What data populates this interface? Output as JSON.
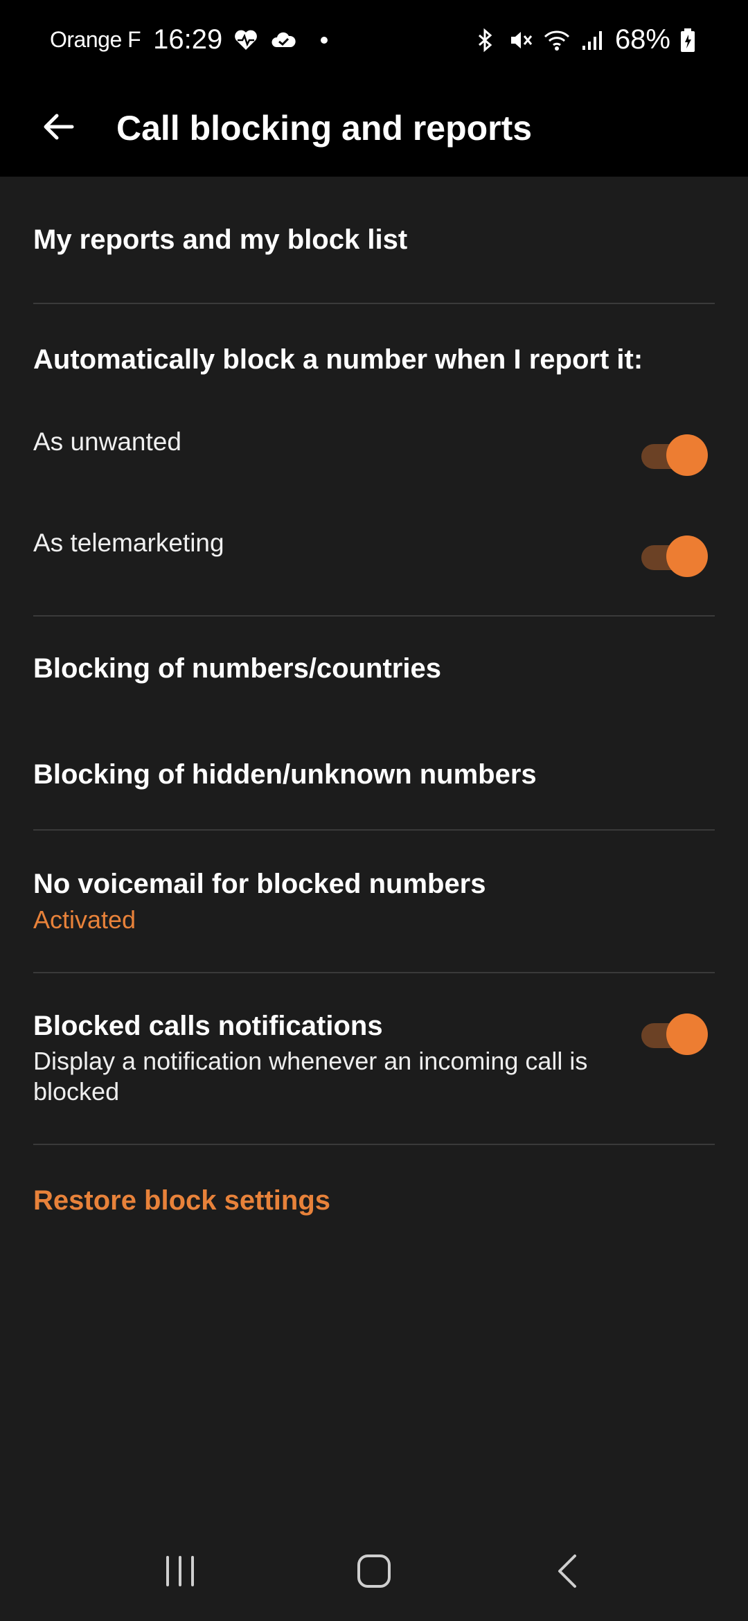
{
  "status_bar": {
    "carrier": "Orange F",
    "time": "16:29",
    "battery": "68%",
    "icons": [
      "heart-monitor-icon",
      "cloud-check-icon",
      "bluetooth-icon",
      "mute-icon",
      "wifi-icon",
      "signal-icon",
      "battery-icon"
    ]
  },
  "header": {
    "title": "Call blocking and reports",
    "back_icon": "arrow-left-icon"
  },
  "items": {
    "my_reports": "My reports and my block list",
    "auto_block_heading": "Automatically block a number when I report it:",
    "as_unwanted": "As unwanted",
    "as_telemarketing": "As telemarketing",
    "blocking_countries": "Blocking of numbers/countries",
    "blocking_hidden": "Blocking of hidden/unknown numbers",
    "no_voicemail_title": "No voicemail for blocked numbers",
    "no_voicemail_status": "Activated",
    "notifications_title": "Blocked calls notifications",
    "notifications_sub": "Display a notification whenever an incoming call is blocked",
    "restore": "Restore block settings"
  },
  "toggles": {
    "as_unwanted": true,
    "as_telemarketing": true,
    "notifications": true
  },
  "colors": {
    "accent": "#e8823a",
    "toggle_thumb": "#ed7d32",
    "toggle_track": "#6b4125",
    "background": "#1c1c1c"
  },
  "nav": [
    "recents-icon",
    "home-icon",
    "back-icon"
  ]
}
